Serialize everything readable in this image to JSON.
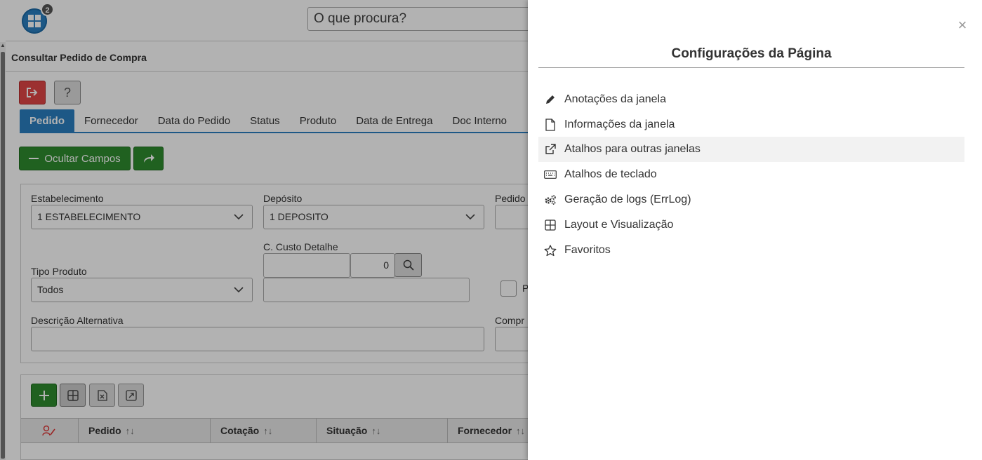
{
  "header": {
    "notification_count": "2",
    "search_placeholder": "O que procura?"
  },
  "window": {
    "title": "Consultar Pedido de Compra"
  },
  "tabs": [
    {
      "label": "Pedido"
    },
    {
      "label": "Fornecedor"
    },
    {
      "label": "Data do Pedido"
    },
    {
      "label": "Status"
    },
    {
      "label": "Produto"
    },
    {
      "label": "Data de Entrega"
    },
    {
      "label": "Doc Interno"
    }
  ],
  "toolbar": {
    "hide_fields_label": "Ocultar Campos",
    "help_label": "?"
  },
  "form": {
    "estabelecimento": {
      "label": "Estabelecimento",
      "value": "1 ESTABELECIMENTO"
    },
    "deposito": {
      "label": "Depósito",
      "value": "1 DEPOSITO"
    },
    "pedido": {
      "label": "Pedido"
    },
    "custo": {
      "label": "C. Custo Detalhe",
      "number": "0"
    },
    "tipo_produto": {
      "label": "Tipo Produto",
      "value": "Todos"
    },
    "checkbox_label": "P",
    "descricao": {
      "label": "Descrição Alternativa"
    },
    "comprador": {
      "label": "Compr"
    }
  },
  "grid": {
    "columns": [
      {
        "label": "Pedido",
        "sort": "↑↓"
      },
      {
        "label": "Cotação",
        "sort": "↑↓"
      },
      {
        "label": "Situação",
        "sort": "↑↓"
      },
      {
        "label": "Fornecedor",
        "sort": "↑↓"
      }
    ]
  },
  "drawer": {
    "title": "Configurações da Página",
    "close": "×",
    "items": [
      {
        "label": "Anotações da janela",
        "icon": "pencil-icon"
      },
      {
        "label": "Informações da janela",
        "icon": "document-icon"
      },
      {
        "label": "Atalhos para outras janelas",
        "icon": "external-link-icon"
      },
      {
        "label": "Atalhos de teclado",
        "icon": "keyboard-icon"
      },
      {
        "label": "Geração de logs (ErrLog)",
        "icon": "gears-icon"
      },
      {
        "label": "Layout e Visualização",
        "icon": "grid-layout-icon"
      },
      {
        "label": "Favoritos",
        "icon": "star-icon"
      }
    ]
  }
}
